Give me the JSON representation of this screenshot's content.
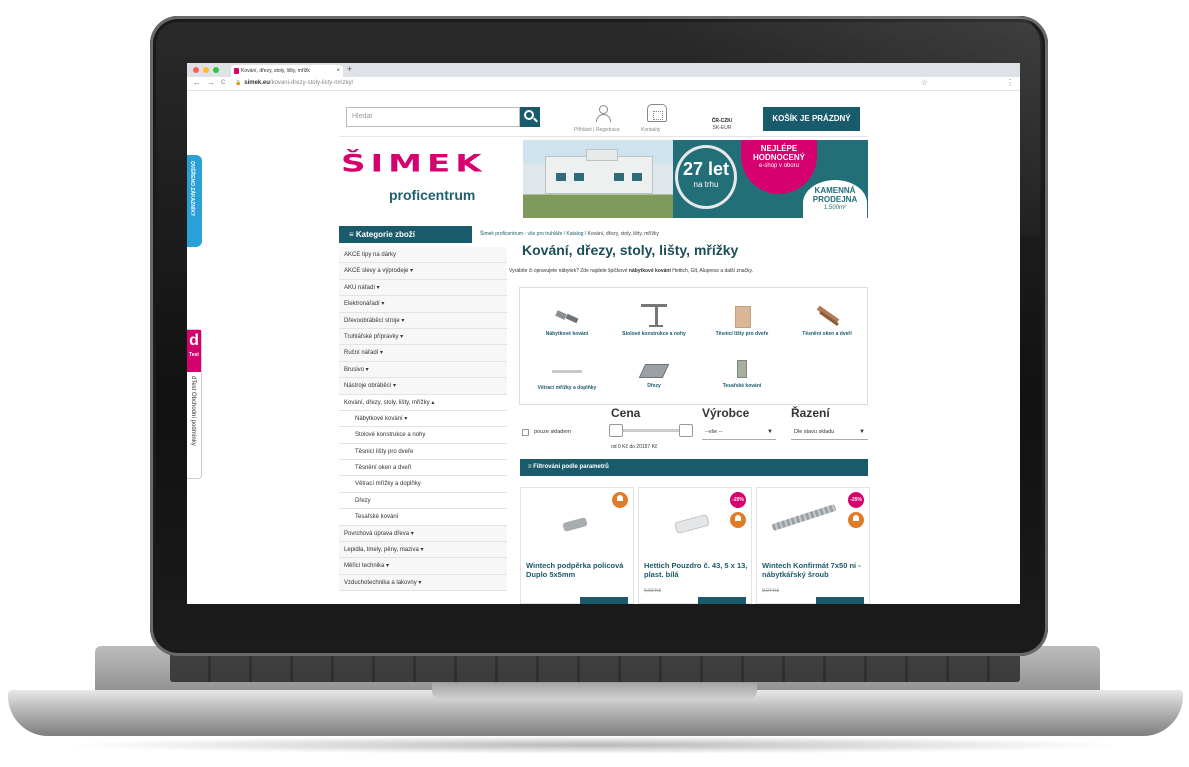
{
  "browser": {
    "tab_title": "Kování, dřezy, stoly, lišty, mřížk",
    "tab_close": "×",
    "new_tab": "+",
    "nav_back": "←",
    "nav_forward": "→",
    "nav_reload": "C",
    "url_host": "simek.eu",
    "url_path": "/kovani-drezy-stoly-listy-mrizky/",
    "bookmark": "☆",
    "menu": "⋮",
    "lock": "🔒"
  },
  "header": {
    "search_placeholder": "Hledat",
    "login_label": "Přihlásit | Registrace",
    "contacts_label": "Kontakty",
    "currency_primary": "ČR-CZK/",
    "currency_secondary": "SK-EUR",
    "cart_label": "KOŠÍK JE PRÁZDNÝ"
  },
  "logo": {
    "wordmark": "ŠIMEK",
    "subtitle": "proficentrum"
  },
  "banner": {
    "years": "27 let",
    "years_sub": "na trhu",
    "best_line1": "NEJLÉPE",
    "best_line2": "HODNOCENÝ",
    "best_line3": "e-shop v oboru",
    "store_line1": "KAMENNÁ",
    "store_line2": "PRODEJNA",
    "store_line3": "1.500m²"
  },
  "side": {
    "verify_label": "OVĚŘENO ZÁKAZNÍKY",
    "dtest_logo": "d",
    "dtest_word": "Test",
    "dtest_label": "dTest Obchodní podmínky"
  },
  "sidebar": {
    "title": "≡  Kategorie zboží",
    "items": [
      {
        "label": "AKCE tipy na dárky",
        "sub": false
      },
      {
        "label": "AKCE slevy a výprodeje ▾",
        "sub": false
      },
      {
        "label": "AKU nářadí ▾",
        "sub": false
      },
      {
        "label": "Elektronářadí ▾",
        "sub": false
      },
      {
        "label": "Dřevoobráběcí stroje ▾",
        "sub": false
      },
      {
        "label": "Truhlářské přípravky ▾",
        "sub": false
      },
      {
        "label": "Ruční nářadí ▾",
        "sub": false
      },
      {
        "label": "Brusivo ▾",
        "sub": false
      },
      {
        "label": "Nástroje obráběcí ▾",
        "sub": false
      },
      {
        "label": "Kování, dřezy, stoly, lišty, mřížky ▴",
        "sub": false
      },
      {
        "label": "Nábytkové kování ▾",
        "sub": true
      },
      {
        "label": "Stolové konstrukce a nohy",
        "sub": true
      },
      {
        "label": "Těsnicí lišty pro dveře",
        "sub": true
      },
      {
        "label": "Těsnění oken a dveří",
        "sub": true
      },
      {
        "label": "Větrací mřížky a doplňky",
        "sub": true
      },
      {
        "label": "Dřezy",
        "sub": true
      },
      {
        "label": "Tesařské kování",
        "sub": true
      },
      {
        "label": "Povrchová úprava dřeva ▾",
        "sub": false
      },
      {
        "label": "Lepidla, tmely, pěny, maziva ▾",
        "sub": false
      },
      {
        "label": "Měřicí technika ▾",
        "sub": false
      },
      {
        "label": "Vzduchotechnika a lakovny ▾",
        "sub": false
      }
    ]
  },
  "main": {
    "breadcrumb_link": "Šimek proficentrum - vše pro truhláře / Katalog / ",
    "breadcrumb_current": "Kování, dřezy, stoly, lišty, mřížky",
    "title": "Kování, dřezy, stoly, lišty, mřížky",
    "intro_start": "Vyrábíte či opravujete nábytek? Zde najdete špičkové ",
    "intro_bold": "nábytkové kování",
    "intro_end": " Hettich, Glt, Alupress a další značky.",
    "subcategories": [
      "Nábytkové kování",
      "Stolové konstrukce a nohy",
      "Těsnicí lišty pro dveře",
      "Těsnění oken a dveří",
      "Větrací mřížky a doplňky",
      "Dřezy",
      "Tesařské kování"
    ]
  },
  "filters": {
    "stock_label": "pouze skladem",
    "price_title": "Cena",
    "price_range": "od 0 Kč  do  20157 Kč",
    "producer_title": "Výrobce",
    "producer_value": "--vše --",
    "sort_title": "Řazení",
    "sort_value": "Dle stavu skladu",
    "param_bar": "≡  Filtrování podle parametrů"
  },
  "products": [
    {
      "name": "Wintech podpěrka policová Duplo 5x5mm",
      "discount": "",
      "old_price": ""
    },
    {
      "name": "Hettich Pouzdro č. 43, 5 x 13, plast. bílá",
      "discount": "-20%",
      "old_price": "0,60 Kč"
    },
    {
      "name": "Wintech Konfirmát 7x50 ni - nábytkářský šroub",
      "discount": "-25%",
      "old_price": "0,97 Kč"
    }
  ],
  "colors": {
    "brand_teal": "#1a5b6b",
    "brand_pink": "#d6006e"
  }
}
